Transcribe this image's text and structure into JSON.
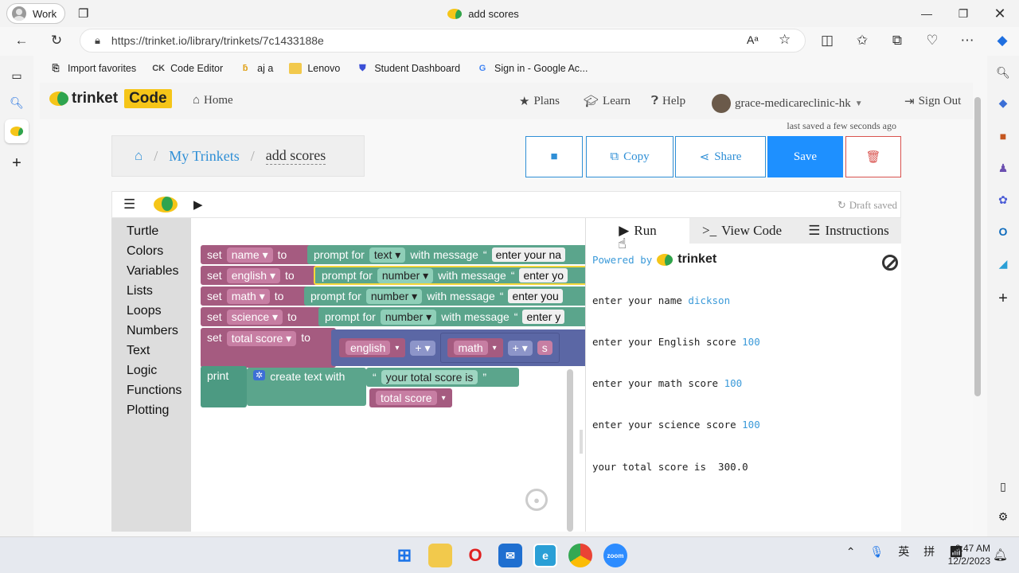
{
  "browser": {
    "profile_label": "Work",
    "tab_title": "add scores",
    "url": "https://trinket.io/library/trinkets/7c1433188e",
    "bookmarks": [
      "Import favorites",
      "Code Editor",
      "aj a",
      "Lenovo",
      "Student Dashboard",
      "Sign in - Google Ac..."
    ]
  },
  "site": {
    "logo_text": "trinket",
    "logo_badge": "Code",
    "home": "Home",
    "plans": "Plans",
    "learn": "Learn",
    "help": "Help",
    "user": "grace-medicareclinic-hk",
    "signout": "Sign Out",
    "last_saved": "last saved a few seconds ago"
  },
  "breadcrumb": {
    "my_trinkets": "My Trinkets",
    "current": "add scores"
  },
  "toolbar": {
    "copy": "Copy",
    "share": "Share",
    "save": "Save"
  },
  "editor": {
    "draft_status": "Draft saved"
  },
  "toolbox": [
    "Turtle",
    "Colors",
    "Variables",
    "Lists",
    "Loops",
    "Numbers",
    "Text",
    "Logic",
    "Functions",
    "Plotting"
  ],
  "blocks": {
    "set": "set",
    "to": "to",
    "prompt_for": "prompt for",
    "with_message": "with message",
    "print": "print",
    "create_text_with": "create text with",
    "plus": "+",
    "var_name": "name",
    "var_english": "english",
    "var_math": "math",
    "var_science": "science",
    "var_total": "total score",
    "type_text": "text",
    "type_number": "number",
    "msg_name": "enter your na",
    "msg_english": "enter yo",
    "msg_math": "enter you",
    "msg_science": "enter y",
    "str_total": "your total score is",
    "truncated_s": "s"
  },
  "output": {
    "tab_run": "Run",
    "tab_code": "View Code",
    "tab_instructions": "Instructions",
    "powered_by": "Powered by",
    "powered_logo": "trinket",
    "lines": [
      {
        "prompt": "enter your name ",
        "input": "dickson"
      },
      {
        "prompt": "enter your English score ",
        "input": "100"
      },
      {
        "prompt": "enter your math score ",
        "input": "100"
      },
      {
        "prompt": "enter your science score ",
        "input": "100"
      },
      {
        "prompt": "your total score is  300.0",
        "input": ""
      }
    ]
  },
  "taskbar": {
    "ime1": "英",
    "ime2": "拼",
    "time": "9:47 AM",
    "date": "12/2/2023"
  },
  "colors": {
    "accent": "#2f8fd6",
    "save_bg": "#1e90ff",
    "trash": "#d9534f",
    "input_text": "#3b9ad9"
  }
}
